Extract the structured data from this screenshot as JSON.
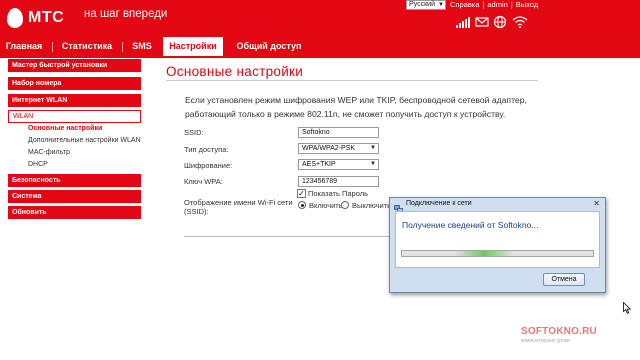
{
  "header": {
    "logo_text": "МТС",
    "slogan": "на шаг впереди",
    "language": "Русский",
    "links": [
      "Справка",
      "admin",
      "Выход"
    ]
  },
  "nav": {
    "tabs": [
      "Главная",
      "Статистика",
      "SMS",
      "Настройки",
      "Общий доступ"
    ],
    "active_tab": "Настройки"
  },
  "sidebar": {
    "items": [
      "Мастер быстрой установки",
      "Набор номера",
      "Интернет WLAN",
      "WLAN",
      "Безопасность",
      "Система",
      "Обновить"
    ],
    "wlan_subitems": [
      "Основные настройки",
      "Дополнительные настройки WLAN",
      "MAC-фильтр",
      "DHCP"
    ]
  },
  "main": {
    "title": "Основные настройки",
    "description": "Если установлен режим шифрования WEP или TKIP, беспроводной сетевой адаптер, работающий только в режиме 802.11n, не сможет получить доступ к устройству.",
    "fields": {
      "ssid_label": "SSID:",
      "ssid_value": "Softokno",
      "access_type_label": "Тип доступа:",
      "access_type_value": "WPA/WPA2-PSK",
      "encryption_label": "Шифрование:",
      "encryption_value": "AES+TKIP",
      "wpa_key_label": "Ключ WPA:",
      "wpa_key_value": "123456789",
      "show_password_label": "Показать Пароль",
      "ssid_display_label_1": "Отображение имени Wi-Fi сети",
      "ssid_display_label_2": "(SSID):",
      "radio_on_label": "Включить",
      "radio_off_label": "Выключить"
    }
  },
  "dialog": {
    "title": "Подключение к сети",
    "message": "Получение сведений от Softokno...",
    "cancel_label": "Отмена",
    "progress_note": "indeterminate"
  },
  "watermark": {
    "text": "SOFTOKNO.RU",
    "subtitle": "компьютерные уроки"
  },
  "colors": {
    "brand_red": "#e30613",
    "dialog_frame": "#cfdff0",
    "dialog_text": "#1e3f85"
  }
}
